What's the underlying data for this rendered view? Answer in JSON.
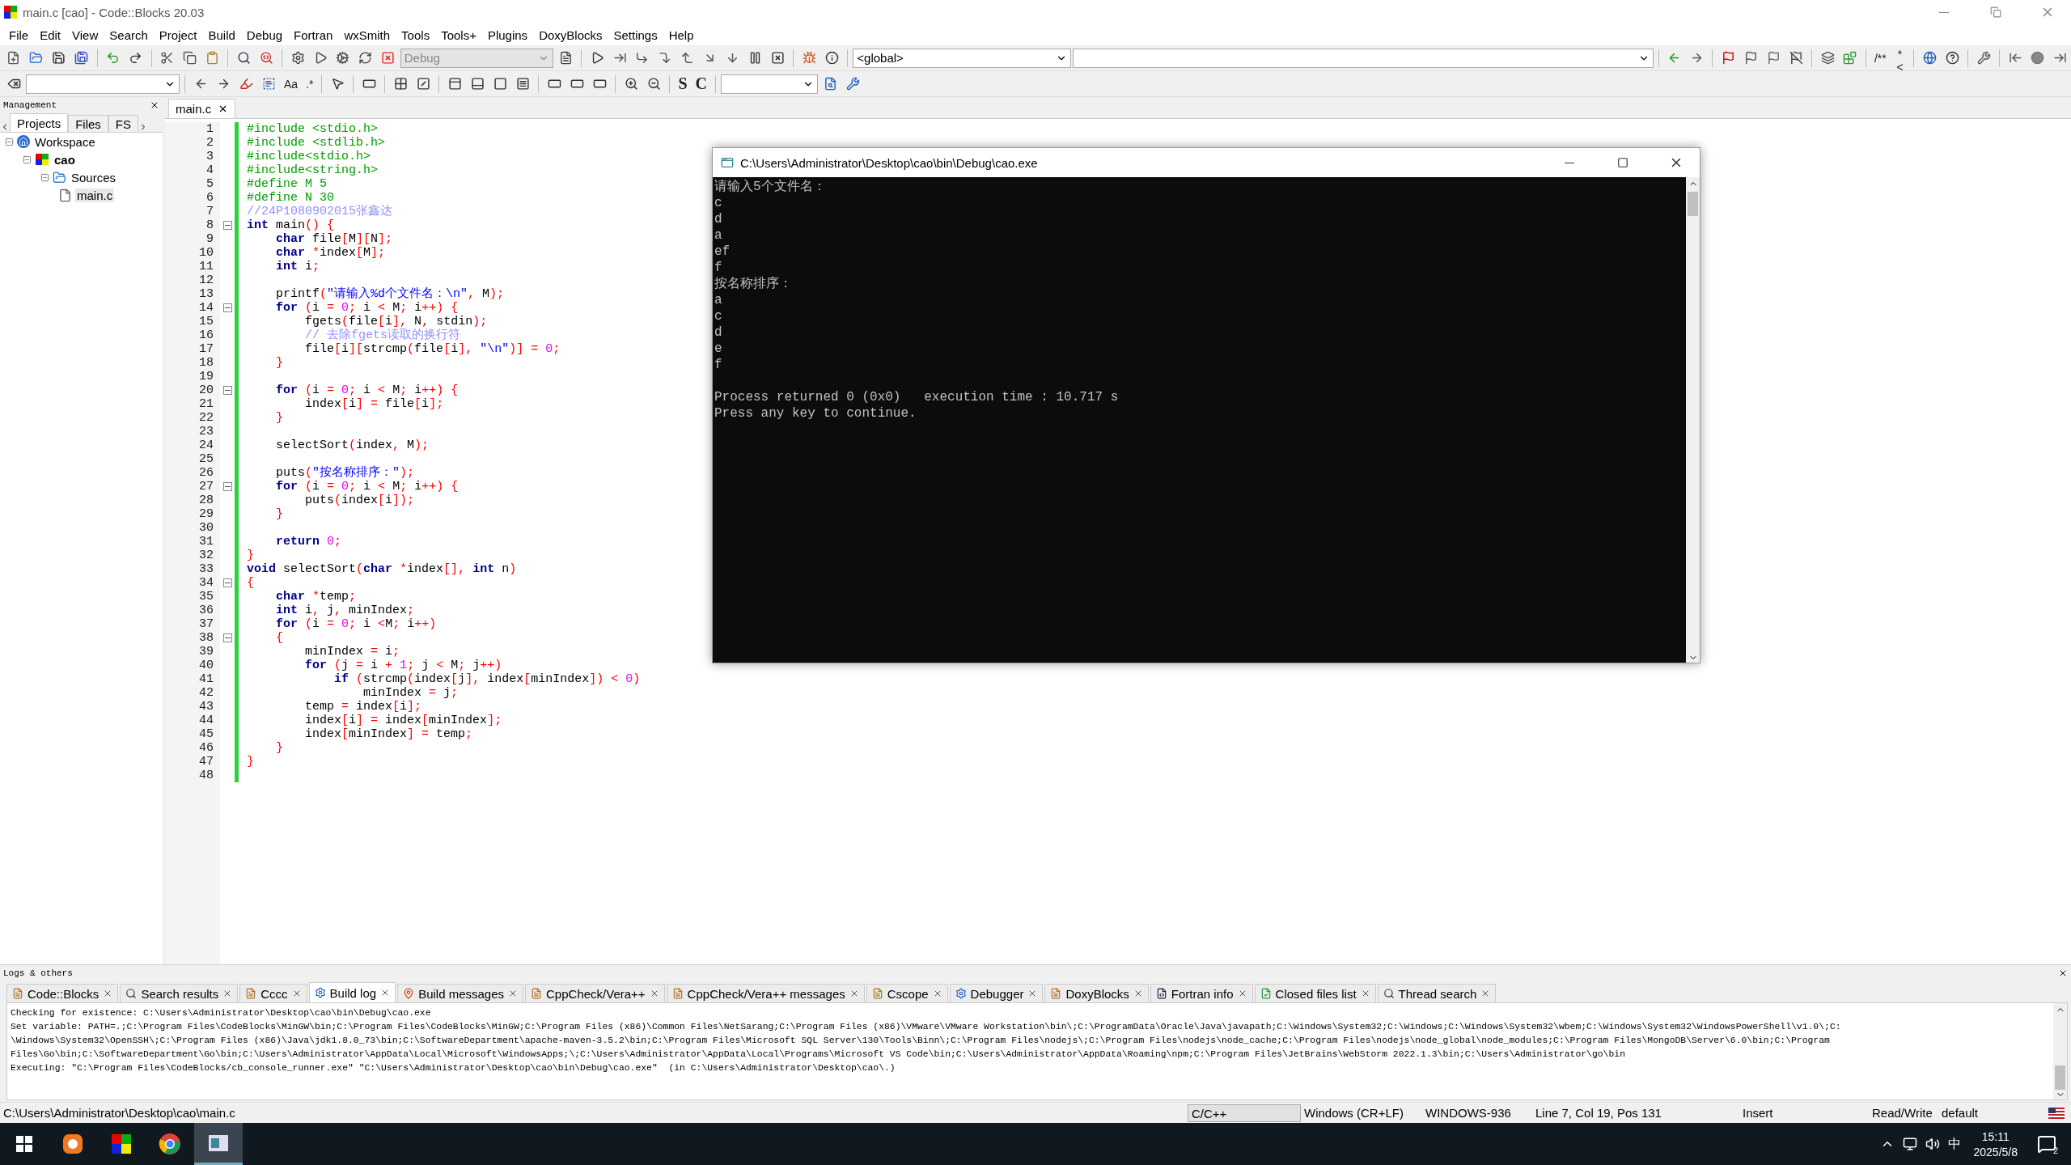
{
  "window": {
    "title": "main.c [cao] - Code::Blocks 20.03"
  },
  "menu": [
    "File",
    "Edit",
    "View",
    "Search",
    "Project",
    "Build",
    "Debug",
    "Fortran",
    "wxSmith",
    "Tools",
    "Tools+",
    "Plugins",
    "DoxyBlocks",
    "Settings",
    "Help"
  ],
  "toolbar": {
    "build_target": "Debug",
    "scope": "<global>",
    "text_buttons": [
      "Aa",
      ".*",
      "S",
      "C",
      "/**",
      "*<"
    ]
  },
  "management": {
    "title": "Management",
    "tabs": [
      {
        "label": "Projects",
        "selected": true
      },
      {
        "label": "Files",
        "selected": false
      },
      {
        "label": "FS",
        "selected": false
      }
    ],
    "tree": [
      {
        "label": "Workspace",
        "kind": "workspace",
        "children": [
          {
            "label": "cao",
            "kind": "project",
            "bold": true,
            "children": [
              {
                "label": "Sources",
                "kind": "folder",
                "children": [
                  {
                    "label": "main.c",
                    "kind": "file",
                    "selected": true
                  }
                ]
              }
            ]
          }
        ]
      }
    ]
  },
  "editor": {
    "tabs": [
      {
        "label": "main.c",
        "selected": true
      }
    ],
    "lines": [
      {
        "n": "1",
        "t": [
          {
            "kind": "directive",
            "text": "#include <stdio.h>"
          }
        ]
      },
      {
        "n": "2",
        "t": [
          {
            "kind": "directive",
            "text": "#include <stdlib.h>"
          }
        ]
      },
      {
        "n": "3",
        "t": [
          {
            "kind": "directive",
            "text": "#include<stdio.h>"
          }
        ]
      },
      {
        "n": "4",
        "t": [
          {
            "kind": "directive",
            "text": "#include<string.h>"
          }
        ]
      },
      {
        "n": "5",
        "t": [
          {
            "kind": "directive",
            "text": "#define M 5"
          }
        ]
      },
      {
        "n": "6",
        "t": [
          {
            "kind": "directive",
            "text": "#define N 30"
          }
        ]
      },
      {
        "n": "7",
        "t": [
          {
            "kind": "comment",
            "text": "//24P1080902015张鑫达"
          }
        ]
      },
      {
        "n": "8",
        "fold": true,
        "t": [
          {
            "kind": "keyword",
            "text": "int"
          },
          {
            "kind": "plain",
            "text": " main"
          },
          {
            "kind": "operator",
            "text": "() {"
          }
        ]
      },
      {
        "n": "9",
        "t": [
          {
            "kind": "keyword",
            "text": "    char"
          },
          {
            "kind": "plain",
            "text": " file"
          },
          {
            "kind": "operator",
            "text": "["
          },
          {
            "kind": "plain",
            "text": "M"
          },
          {
            "kind": "operator",
            "text": "]["
          },
          {
            "kind": "plain",
            "text": "N"
          },
          {
            "kind": "operator",
            "text": "];"
          }
        ]
      },
      {
        "n": "10",
        "t": [
          {
            "kind": "keyword",
            "text": "    char"
          },
          {
            "kind": "operator",
            "text": " *"
          },
          {
            "kind": "plain",
            "text": "index"
          },
          {
            "kind": "operator",
            "text": "["
          },
          {
            "kind": "plain",
            "text": "M"
          },
          {
            "kind": "operator",
            "text": "];"
          }
        ]
      },
      {
        "n": "11",
        "t": [
          {
            "kind": "keyword",
            "text": "    int"
          },
          {
            "kind": "plain",
            "text": " i"
          },
          {
            "kind": "operator",
            "text": ";"
          }
        ]
      },
      {
        "n": "12"
      },
      {
        "n": "13",
        "t": [
          {
            "kind": "plain",
            "text": "    printf"
          },
          {
            "kind": "operator",
            "text": "("
          },
          {
            "kind": "string",
            "text": "\"请输入%d个文件名：\\n\""
          },
          {
            "kind": "operator",
            "text": ", "
          },
          {
            "kind": "plain",
            "text": "M"
          },
          {
            "kind": "operator",
            "text": ");"
          }
        ]
      },
      {
        "n": "14",
        "fold": true,
        "t": [
          {
            "kind": "keyword",
            "text": "    for"
          },
          {
            "kind": "operator",
            "text": " ("
          },
          {
            "kind": "plain",
            "text": "i "
          },
          {
            "kind": "operator",
            "text": "= "
          },
          {
            "kind": "number",
            "text": "0"
          },
          {
            "kind": "operator",
            "text": "; "
          },
          {
            "kind": "plain",
            "text": "i "
          },
          {
            "kind": "operator",
            "text": "< "
          },
          {
            "kind": "plain",
            "text": "M"
          },
          {
            "kind": "operator",
            "text": "; "
          },
          {
            "kind": "plain",
            "text": "i"
          },
          {
            "kind": "operator",
            "text": "++) {"
          }
        ]
      },
      {
        "n": "15",
        "t": [
          {
            "kind": "plain",
            "text": "        fgets"
          },
          {
            "kind": "operator",
            "text": "("
          },
          {
            "kind": "plain",
            "text": "file"
          },
          {
            "kind": "operator",
            "text": "["
          },
          {
            "kind": "plain",
            "text": "i"
          },
          {
            "kind": "operator",
            "text": "], "
          },
          {
            "kind": "plain",
            "text": "N"
          },
          {
            "kind": "operator",
            "text": ", "
          },
          {
            "kind": "plain",
            "text": "stdin"
          },
          {
            "kind": "operator",
            "text": ");"
          }
        ]
      },
      {
        "n": "16",
        "t": [
          {
            "kind": "comment",
            "text": "        // 去除fgets读取的换行符"
          }
        ]
      },
      {
        "n": "17",
        "t": [
          {
            "kind": "plain",
            "text": "        file"
          },
          {
            "kind": "operator",
            "text": "["
          },
          {
            "kind": "plain",
            "text": "i"
          },
          {
            "kind": "operator",
            "text": "]["
          },
          {
            "kind": "plain",
            "text": "strcmp"
          },
          {
            "kind": "operator",
            "text": "("
          },
          {
            "kind": "plain",
            "text": "file"
          },
          {
            "kind": "operator",
            "text": "["
          },
          {
            "kind": "plain",
            "text": "i"
          },
          {
            "kind": "operator",
            "text": "], "
          },
          {
            "kind": "string",
            "text": "\"\\n\""
          },
          {
            "kind": "operator",
            "text": ")] = "
          },
          {
            "kind": "number",
            "text": "0"
          },
          {
            "kind": "operator",
            "text": ";"
          }
        ]
      },
      {
        "n": "18",
        "t": [
          {
            "kind": "operator",
            "text": "    }"
          }
        ]
      },
      {
        "n": "19"
      },
      {
        "n": "20",
        "fold": true,
        "t": [
          {
            "kind": "keyword",
            "text": "    for"
          },
          {
            "kind": "operator",
            "text": " ("
          },
          {
            "kind": "plain",
            "text": "i "
          },
          {
            "kind": "operator",
            "text": "= "
          },
          {
            "kind": "number",
            "text": "0"
          },
          {
            "kind": "operator",
            "text": "; "
          },
          {
            "kind": "plain",
            "text": "i "
          },
          {
            "kind": "operator",
            "text": "< "
          },
          {
            "kind": "plain",
            "text": "M"
          },
          {
            "kind": "operator",
            "text": "; "
          },
          {
            "kind": "plain",
            "text": "i"
          },
          {
            "kind": "operator",
            "text": "++) {"
          }
        ]
      },
      {
        "n": "21",
        "t": [
          {
            "kind": "plain",
            "text": "        index"
          },
          {
            "kind": "operator",
            "text": "["
          },
          {
            "kind": "plain",
            "text": "i"
          },
          {
            "kind": "operator",
            "text": "] = "
          },
          {
            "kind": "plain",
            "text": "file"
          },
          {
            "kind": "operator",
            "text": "["
          },
          {
            "kind": "plain",
            "text": "i"
          },
          {
            "kind": "operator",
            "text": "];"
          }
        ]
      },
      {
        "n": "22",
        "t": [
          {
            "kind": "operator",
            "text": "    }"
          }
        ]
      },
      {
        "n": "23"
      },
      {
        "n": "24",
        "t": [
          {
            "kind": "plain",
            "text": "    selectSort"
          },
          {
            "kind": "operator",
            "text": "("
          },
          {
            "kind": "plain",
            "text": "index"
          },
          {
            "kind": "operator",
            "text": ", "
          },
          {
            "kind": "plain",
            "text": "M"
          },
          {
            "kind": "operator",
            "text": ");"
          }
        ]
      },
      {
        "n": "25"
      },
      {
        "n": "26",
        "t": [
          {
            "kind": "plain",
            "text": "    puts"
          },
          {
            "kind": "operator",
            "text": "("
          },
          {
            "kind": "string",
            "text": "\"按名称排序：\""
          },
          {
            "kind": "operator",
            "text": ");"
          }
        ]
      },
      {
        "n": "27",
        "fold": true,
        "t": [
          {
            "kind": "keyword",
            "text": "    for"
          },
          {
            "kind": "operator",
            "text": " ("
          },
          {
            "kind": "plain",
            "text": "i "
          },
          {
            "kind": "operator",
            "text": "= "
          },
          {
            "kind": "number",
            "text": "0"
          },
          {
            "kind": "operator",
            "text": "; "
          },
          {
            "kind": "plain",
            "text": "i "
          },
          {
            "kind": "operator",
            "text": "< "
          },
          {
            "kind": "plain",
            "text": "M"
          },
          {
            "kind": "operator",
            "text": "; "
          },
          {
            "kind": "plain",
            "text": "i"
          },
          {
            "kind": "operator",
            "text": "++) {"
          }
        ]
      },
      {
        "n": "28",
        "t": [
          {
            "kind": "plain",
            "text": "        puts"
          },
          {
            "kind": "operator",
            "text": "("
          },
          {
            "kind": "plain",
            "text": "index"
          },
          {
            "kind": "operator",
            "text": "["
          },
          {
            "kind": "plain",
            "text": "i"
          },
          {
            "kind": "operator",
            "text": "]);"
          }
        ]
      },
      {
        "n": "29",
        "t": [
          {
            "kind": "operator",
            "text": "    }"
          }
        ]
      },
      {
        "n": "30"
      },
      {
        "n": "31",
        "t": [
          {
            "kind": "keyword",
            "text": "    return"
          },
          {
            "kind": "number",
            "text": " 0"
          },
          {
            "kind": "operator",
            "text": ";"
          }
        ]
      },
      {
        "n": "32",
        "t": [
          {
            "kind": "operator",
            "text": "}"
          }
        ]
      },
      {
        "n": "33",
        "t": [
          {
            "kind": "keyword",
            "text": "void"
          },
          {
            "kind": "plain",
            "text": " selectSort"
          },
          {
            "kind": "operator",
            "text": "("
          },
          {
            "kind": "keyword",
            "text": "char"
          },
          {
            "kind": "operator",
            "text": " *"
          },
          {
            "kind": "plain",
            "text": "index"
          },
          {
            "kind": "operator",
            "text": "[], "
          },
          {
            "kind": "keyword",
            "text": "int"
          },
          {
            "kind": "plain",
            "text": " n"
          },
          {
            "kind": "operator",
            "text": ")"
          }
        ]
      },
      {
        "n": "34",
        "fold": true,
        "t": [
          {
            "kind": "operator",
            "text": "{"
          }
        ]
      },
      {
        "n": "35",
        "t": [
          {
            "kind": "keyword",
            "text": "    char"
          },
          {
            "kind": "operator",
            "text": " *"
          },
          {
            "kind": "plain",
            "text": "temp"
          },
          {
            "kind": "operator",
            "text": ";"
          }
        ]
      },
      {
        "n": "36",
        "t": [
          {
            "kind": "keyword",
            "text": "    int"
          },
          {
            "kind": "plain",
            "text": " i"
          },
          {
            "kind": "operator",
            "text": ", "
          },
          {
            "kind": "plain",
            "text": "j"
          },
          {
            "kind": "operator",
            "text": ", "
          },
          {
            "kind": "plain",
            "text": "minIndex"
          },
          {
            "kind": "operator",
            "text": ";"
          }
        ]
      },
      {
        "n": "37",
        "t": [
          {
            "kind": "keyword",
            "text": "    for"
          },
          {
            "kind": "operator",
            "text": " ("
          },
          {
            "kind": "plain",
            "text": "i "
          },
          {
            "kind": "operator",
            "text": "= "
          },
          {
            "kind": "number",
            "text": "0"
          },
          {
            "kind": "operator",
            "text": "; "
          },
          {
            "kind": "plain",
            "text": "i "
          },
          {
            "kind": "operator",
            "text": "<"
          },
          {
            "kind": "plain",
            "text": "M"
          },
          {
            "kind": "operator",
            "text": "; "
          },
          {
            "kind": "plain",
            "text": "i"
          },
          {
            "kind": "operator",
            "text": "++)"
          }
        ]
      },
      {
        "n": "38",
        "fold": true,
        "t": [
          {
            "kind": "operator",
            "text": "    {"
          }
        ]
      },
      {
        "n": "39",
        "t": [
          {
            "kind": "plain",
            "text": "        minIndex "
          },
          {
            "kind": "operator",
            "text": "= "
          },
          {
            "kind": "plain",
            "text": "i"
          },
          {
            "kind": "operator",
            "text": ";"
          }
        ]
      },
      {
        "n": "40",
        "t": [
          {
            "kind": "keyword",
            "text": "        for"
          },
          {
            "kind": "operator",
            "text": " ("
          },
          {
            "kind": "plain",
            "text": "j "
          },
          {
            "kind": "operator",
            "text": "= "
          },
          {
            "kind": "plain",
            "text": "i "
          },
          {
            "kind": "operator",
            "text": "+ "
          },
          {
            "kind": "number",
            "text": "1"
          },
          {
            "kind": "operator",
            "text": "; "
          },
          {
            "kind": "plain",
            "text": "j "
          },
          {
            "kind": "operator",
            "text": "< "
          },
          {
            "kind": "plain",
            "text": "M"
          },
          {
            "kind": "operator",
            "text": "; "
          },
          {
            "kind": "plain",
            "text": "j"
          },
          {
            "kind": "operator",
            "text": "++)"
          }
        ]
      },
      {
        "n": "41",
        "t": [
          {
            "kind": "keyword",
            "text": "            if"
          },
          {
            "kind": "operator",
            "text": " ("
          },
          {
            "kind": "plain",
            "text": "strcmp"
          },
          {
            "kind": "operator",
            "text": "("
          },
          {
            "kind": "plain",
            "text": "index"
          },
          {
            "kind": "operator",
            "text": "["
          },
          {
            "kind": "plain",
            "text": "j"
          },
          {
            "kind": "operator",
            "text": "], "
          },
          {
            "kind": "plain",
            "text": "index"
          },
          {
            "kind": "operator",
            "text": "["
          },
          {
            "kind": "plain",
            "text": "minIndex"
          },
          {
            "kind": "operator",
            "text": "]) < "
          },
          {
            "kind": "number",
            "text": "0"
          },
          {
            "kind": "operator",
            "text": ")"
          }
        ]
      },
      {
        "n": "42",
        "t": [
          {
            "kind": "plain",
            "text": "                minIndex "
          },
          {
            "kind": "operator",
            "text": "= "
          },
          {
            "kind": "plain",
            "text": "j"
          },
          {
            "kind": "operator",
            "text": ";"
          }
        ]
      },
      {
        "n": "43",
        "t": [
          {
            "kind": "plain",
            "text": "        temp "
          },
          {
            "kind": "operator",
            "text": "= "
          },
          {
            "kind": "plain",
            "text": "index"
          },
          {
            "kind": "operator",
            "text": "["
          },
          {
            "kind": "plain",
            "text": "i"
          },
          {
            "kind": "operator",
            "text": "];"
          }
        ]
      },
      {
        "n": "44",
        "t": [
          {
            "kind": "plain",
            "text": "        index"
          },
          {
            "kind": "operator",
            "text": "["
          },
          {
            "kind": "plain",
            "text": "i"
          },
          {
            "kind": "operator",
            "text": "] = "
          },
          {
            "kind": "plain",
            "text": "index"
          },
          {
            "kind": "operator",
            "text": "["
          },
          {
            "kind": "plain",
            "text": "minIndex"
          },
          {
            "kind": "operator",
            "text": "];"
          }
        ]
      },
      {
        "n": "45",
        "t": [
          {
            "kind": "plain",
            "text": "        index"
          },
          {
            "kind": "operator",
            "text": "["
          },
          {
            "kind": "plain",
            "text": "minIndex"
          },
          {
            "kind": "operator",
            "text": "] = "
          },
          {
            "kind": "plain",
            "text": "temp"
          },
          {
            "kind": "operator",
            "text": ";"
          }
        ]
      },
      {
        "n": "46",
        "t": [
          {
            "kind": "operator",
            "text": "    }"
          }
        ]
      },
      {
        "n": "47",
        "t": [
          {
            "kind": "operator",
            "text": "}"
          }
        ]
      },
      {
        "n": "48"
      }
    ]
  },
  "console": {
    "title": "C:\\Users\\Administrator\\Desktop\\cao\\bin\\Debug\\cao.exe",
    "output": [
      "请输入5个文件名：",
      "c",
      "d",
      "a",
      "ef",
      "f",
      "按名称排序：",
      "a",
      "c",
      "d",
      "e",
      "f"
    ],
    "exit_message": [
      "Process returned 0 (0x0)   execution time : 10.717 s",
      "Press any key to continue."
    ]
  },
  "logs": {
    "title": "Logs & others",
    "tabs": [
      {
        "label": "Code::Blocks",
        "kind": "doc",
        "selected": false
      },
      {
        "label": "Search results",
        "kind": "search",
        "selected": false
      },
      {
        "label": "Cccc",
        "kind": "doc",
        "selected": false
      },
      {
        "label": "Build log",
        "kind": "gear",
        "selected": true
      },
      {
        "label": "Build messages",
        "kind": "pin",
        "selected": false
      },
      {
        "label": "CppCheck/Vera++",
        "kind": "doc",
        "selected": false
      },
      {
        "label": "CppCheck/Vera++ messages",
        "kind": "doc",
        "selected": false
      },
      {
        "label": "Cscope",
        "kind": "doc",
        "selected": false
      },
      {
        "label": "Debugger",
        "kind": "gear",
        "selected": false
      },
      {
        "label": "DoxyBlocks",
        "kind": "doc",
        "selected": false
      },
      {
        "label": "Fortran info",
        "kind": "fortran",
        "selected": false
      },
      {
        "label": "Closed files list",
        "kind": "closed",
        "selected": false
      },
      {
        "label": "Thread search",
        "kind": "search",
        "selected": false
      }
    ],
    "lines": [
      "Checking for existence: C:\\Users\\Administrator\\Desktop\\cao\\bin\\Debug\\cao.exe",
      "Set variable: PATH=.;C:\\Program Files\\CodeBlocks\\MinGW\\bin;C:\\Program Files\\CodeBlocks\\MinGW;C:\\Program Files (x86)\\Common Files\\NetSarang;C:\\Program Files (x86)\\VMware\\VMware Workstation\\bin\\;C:\\ProgramData\\Oracle\\Java\\javapath;C:\\Windows\\System32;C:\\Windows;C:\\Windows\\System32\\wbem;C:\\Windows\\System32\\WindowsPowerShell\\v1.0\\;C:",
      "\\Windows\\System32\\OpenSSH\\;C:\\Program Files (x86)\\Java\\jdk1.8.0_73\\bin;C:\\SoftwareDepartment\\apache-maven-3.5.2\\bin;C:\\Program Files\\Microsoft SQL Server\\130\\Tools\\Binn\\;C:\\Program Files\\nodejs\\;C:\\Program Files\\nodejs\\node_cache;C:\\Program Files\\nodejs\\node_global\\node_modules;C:\\Program Files\\MongoDB\\Server\\6.0\\bin;C:\\Program",
      "Files\\Go\\bin;C:\\SoftwareDepartment\\Go\\bin;C:\\Users\\Administrator\\AppData\\Local\\Microsoft\\WindowsApps;\\;C:\\Users\\Administrator\\AppData\\Local\\Programs\\Microsoft VS Code\\bin;C:\\Users\\Administrator\\AppData\\Roaming\\npm;C:\\Program Files\\JetBrains\\WebStorm 2022.1.3\\bin;C:\\Users\\Administrator\\go\\bin",
      "Executing: \"C:\\Program Files\\CodeBlocks/cb_console_runner.exe\" \"C:\\Users\\Administrator\\Desktop\\cao\\bin\\Debug\\cao.exe\"  (in C:\\Users\\Administrator\\Desktop\\cao\\.)"
    ]
  },
  "status_bar": {
    "path": "C:\\Users\\Administrator\\Desktop\\cao\\main.c",
    "language": "C/C++",
    "line_endings": "Windows (CR+LF)",
    "encoding": "WINDOWS-936",
    "position": "Line 7, Col 19, Pos 131",
    "mode": "Insert",
    "access": "Read/Write",
    "theme": "default"
  },
  "taskbar": {
    "ime": "中",
    "time": "15:11",
    "date": "2025/5/8",
    "notifications": "2"
  }
}
